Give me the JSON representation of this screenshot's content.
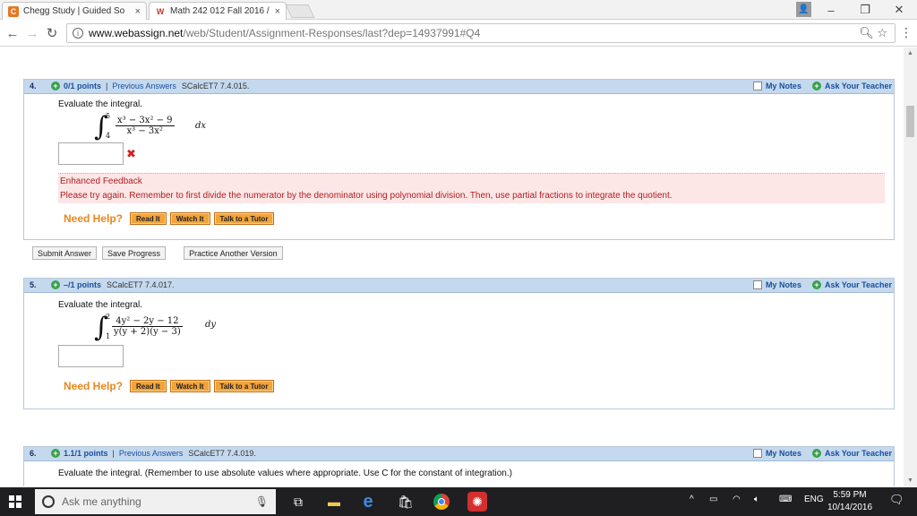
{
  "browser": {
    "tabs": [
      {
        "icon": "C",
        "title": "Chegg Study | Guided So",
        "close": "×"
      },
      {
        "icon": "W",
        "title": "Math 242 012 Fall 2016 /",
        "close": "×"
      }
    ],
    "url_host": "www.webassign.net",
    "url_path": "/web/Student/Assignment-Responses/last?dep=14937991#Q4",
    "minimize": "–",
    "restore": "❐",
    "close": "✕",
    "profile": "👤"
  },
  "questions": [
    {
      "number": "4.",
      "points": "0/1 points",
      "previous": "Previous Answers",
      "ref": "SCalcET7 7.4.015.",
      "prompt": "Evaluate the integral.",
      "upper": "5",
      "lower": "4",
      "numerator": "x³ − 3x² − 9",
      "denominator": "x³ − 3x²",
      "dvar": "dx",
      "wrong_mark": "✖",
      "feedback_title": "Enhanced Feedback",
      "feedback_text": "Please try again. Remember to first divide the numerator by the denominator using polynomial division. Then, use partial fractions to integrate the quotient."
    },
    {
      "number": "5.",
      "points": "–/1 points",
      "ref": "SCalcET7 7.4.017.",
      "prompt": "Evaluate the integral.",
      "upper": "2",
      "lower": "1",
      "numerator": "4y² − 2y − 12",
      "denominator": "y(y + 2)(y − 3)",
      "dvar": "dy"
    },
    {
      "number": "6.",
      "points": "1.1/1 points",
      "previous": "Previous Answers",
      "ref": "SCalcET7 7.4.019.",
      "prompt": "Evaluate the integral. (Remember to use absolute values where appropriate. Use C for the constant of integration.)"
    }
  ],
  "labels": {
    "my_notes": "My Notes",
    "ask_teacher": "Ask Your Teacher",
    "need_help": "Need Help?",
    "read_it": "Read It",
    "watch_it": "Watch It",
    "talk_tutor": "Talk to a Tutor",
    "submit": "Submit Answer",
    "save": "Save Progress",
    "practice": "Practice Another Version"
  },
  "taskbar": {
    "search_placeholder": "Ask me anything",
    "language": "ENG",
    "time": "5:59 PM",
    "date": "10/14/2016"
  },
  "colors": {
    "header_bg": "#c5d9ee",
    "help_orange": "#e8871e",
    "error_red": "#d32020",
    "feedback_bg": "#fde6e6"
  }
}
